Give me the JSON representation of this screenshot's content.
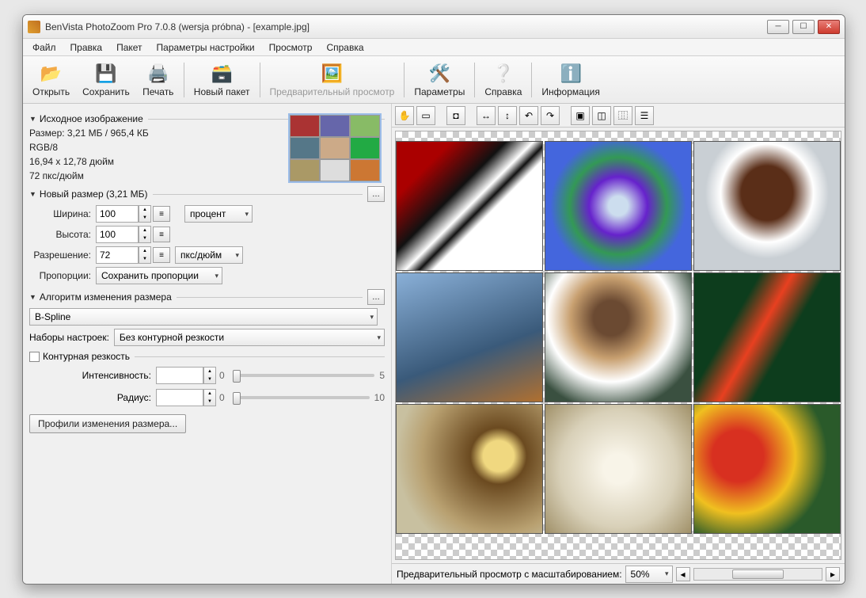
{
  "window": {
    "title": "BenVista PhotoZoom Pro 7.0.8 (wersja próbna) - [example.jpg]"
  },
  "menu": {
    "file": "Файл",
    "edit": "Правка",
    "batch": "Пакет",
    "settings": "Параметры настройки",
    "view": "Просмотр",
    "help": "Справка"
  },
  "toolbar": {
    "open": "Открыть",
    "save": "Сохранить",
    "print": "Печать",
    "newbatch": "Новый пакет",
    "preview": "Предварительный просмотр",
    "params": "Параметры",
    "help": "Справка",
    "info": "Информация"
  },
  "source": {
    "header": "Исходное изображение",
    "size": "Размер: 3,21 МБ / 965,4 КБ",
    "mode": "RGB/8",
    "dims": "16,94 x 12,78 дюйм",
    "dpi": "72 пкс/дюйм"
  },
  "newsize": {
    "header": "Новый размер (3,21 МБ)",
    "width_lbl": "Ширина:",
    "width_val": "100",
    "height_lbl": "Высота:",
    "height_val": "100",
    "unit": "процент",
    "res_lbl": "Разрешение:",
    "res_val": "72",
    "res_unit": "пкс/дюйм",
    "aspect_lbl": "Пропорции:",
    "aspect_val": "Сохранить пропорции"
  },
  "algo": {
    "header": "Алгоритм изменения размера",
    "method": "B-Spline",
    "presets_lbl": "Наборы настроек:",
    "presets_val": "Без контурной резкости",
    "sharpen_chk": "Контурная резкость",
    "intensity_lbl": "Интенсивность:",
    "intensity_min": "0",
    "intensity_max": "5",
    "radius_lbl": "Радиус:",
    "radius_min": "0",
    "radius_max": "10",
    "profiles_btn": "Профили изменения размера..."
  },
  "preview_footer": {
    "label": "Предварительный просмотр с масштабированием:",
    "zoom": "50%"
  }
}
